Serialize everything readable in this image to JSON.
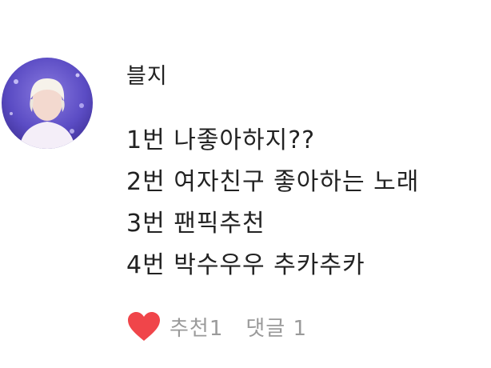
{
  "comment": {
    "author": "블지",
    "lines": [
      "1번 나좋아하지??",
      "2번 여자친구 좋아하는 노래",
      "3번 팬픽추천",
      "4번 박수우우 추카추카"
    ],
    "recommend_label": "추천1",
    "comment_count_label": "댓글 1"
  },
  "icons": {
    "like": "heart-icon",
    "avatar": "avatar"
  },
  "colors": {
    "heart": "#f0454a",
    "muted_text": "#9a9a9a",
    "text": "#222222"
  }
}
